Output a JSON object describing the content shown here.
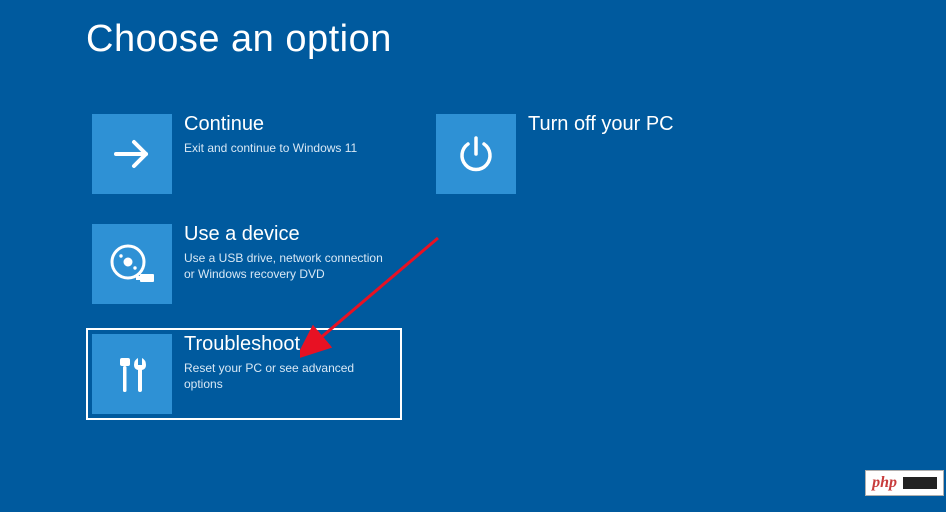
{
  "header": {
    "title": "Choose an option"
  },
  "options": {
    "continue": {
      "title": "Continue",
      "desc": "Exit and continue to Windows 11",
      "icon": "arrow-right-icon"
    },
    "turnoff": {
      "title": "Turn off your PC",
      "desc": "",
      "icon": "power-icon"
    },
    "device": {
      "title": "Use a device",
      "desc": "Use a USB drive, network connection or Windows recovery DVD",
      "icon": "disc-usb-icon"
    },
    "troubleshoot": {
      "title": "Troubleshoot",
      "desc": "Reset your PC or see advanced options",
      "icon": "tools-icon"
    }
  },
  "watermark": {
    "text": "php"
  },
  "colors": {
    "background": "#005A9E",
    "tile": "#2E91D5",
    "arrow": "#E81123"
  }
}
